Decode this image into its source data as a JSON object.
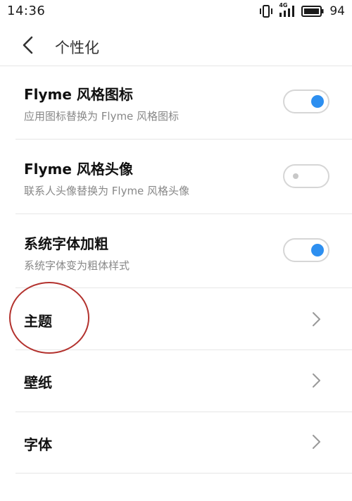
{
  "status_bar": {
    "time": "14:36",
    "network_label": "4G",
    "battery_level": "94"
  },
  "header": {
    "title": "个性化"
  },
  "settings": [
    {
      "title": "Flyme 风格图标",
      "subtitle": "应用图标替换为 Flyme 风格图标",
      "toggle": "on"
    },
    {
      "title": "Flyme 风格头像",
      "subtitle": "联系人头像替换为 Flyme 风格头像",
      "toggle": "off"
    },
    {
      "title": "系统字体加粗",
      "subtitle": "系统字体变为粗体样式",
      "toggle": "on"
    }
  ],
  "nav_items": [
    {
      "title": "主题"
    },
    {
      "title": "壁纸"
    },
    {
      "title": "字体"
    }
  ],
  "colors": {
    "accent": "#2d8ff0",
    "annotation": "#b3322e"
  }
}
